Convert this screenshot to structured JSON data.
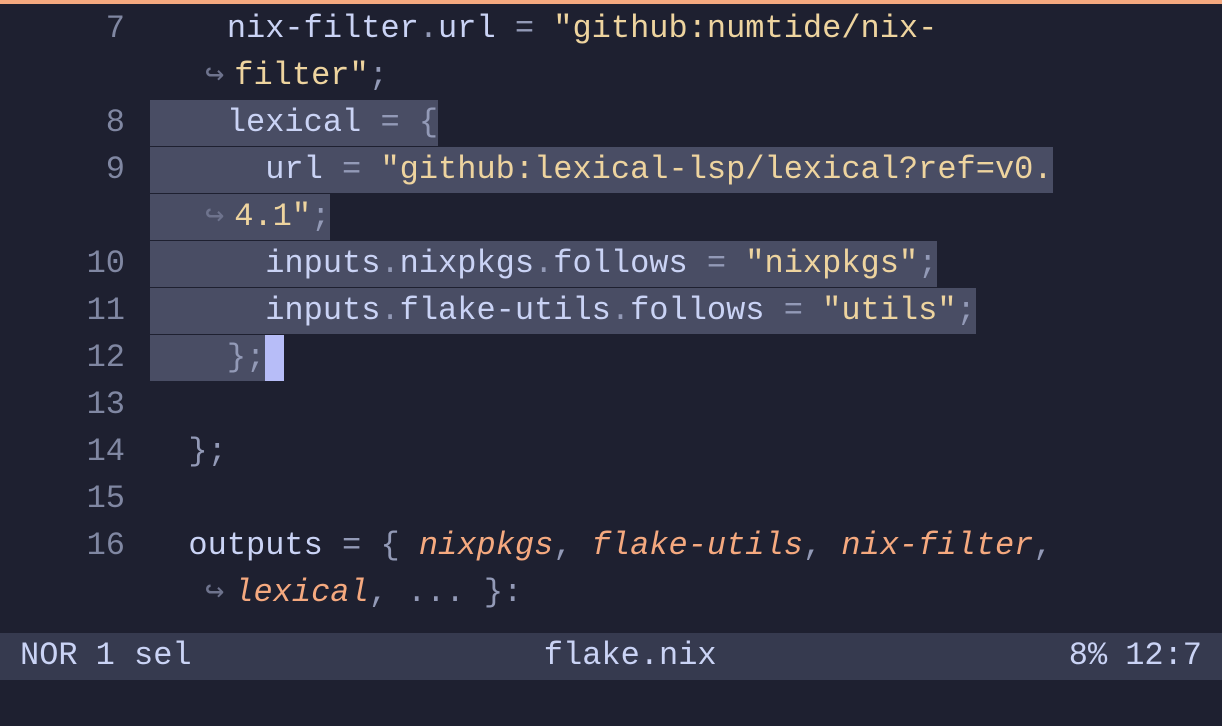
{
  "accent_color": "#f5a97f",
  "lines": [
    {
      "num": "7",
      "segments": [
        {
          "text": "    ",
          "cls": "t-plain"
        },
        {
          "text": "nix-filter",
          "cls": "t-ident"
        },
        {
          "text": ".",
          "cls": "t-punct"
        },
        {
          "text": "url ",
          "cls": "t-ident"
        },
        {
          "text": "=",
          "cls": "t-punct"
        },
        {
          "text": " ",
          "cls": "t-plain"
        },
        {
          "text": "\"github:numtide/nix-",
          "cls": "t-string"
        }
      ]
    },
    {
      "num": "",
      "wrap": true,
      "segments": [
        {
          "text": "filter\"",
          "cls": "t-string"
        },
        {
          "text": ";",
          "cls": "t-punct"
        }
      ]
    },
    {
      "num": "8",
      "segments": [
        {
          "text": "    ",
          "cls": "t-plain sel"
        },
        {
          "text": "lexical ",
          "cls": "t-ident sel"
        },
        {
          "text": "=",
          "cls": "t-punct sel"
        },
        {
          "text": " ",
          "cls": "t-plain sel"
        },
        {
          "text": "{",
          "cls": "t-punct sel"
        }
      ]
    },
    {
      "num": "9",
      "segments": [
        {
          "text": "      ",
          "cls": "t-plain sel"
        },
        {
          "text": "url ",
          "cls": "t-ident sel"
        },
        {
          "text": "=",
          "cls": "t-punct sel"
        },
        {
          "text": " ",
          "cls": "t-plain sel"
        },
        {
          "text": "\"github:lexical-lsp/lexical?ref=v0.",
          "cls": "t-string sel"
        }
      ]
    },
    {
      "num": "",
      "wrap": true,
      "wrap_sel": true,
      "segments": [
        {
          "text": "4.1\"",
          "cls": "t-string sel"
        },
        {
          "text": ";",
          "cls": "t-punct sel"
        }
      ]
    },
    {
      "num": "10",
      "segments": [
        {
          "text": "      ",
          "cls": "t-plain sel"
        },
        {
          "text": "inputs",
          "cls": "t-ident sel"
        },
        {
          "text": ".",
          "cls": "t-punct sel"
        },
        {
          "text": "nixpkgs",
          "cls": "t-ident sel"
        },
        {
          "text": ".",
          "cls": "t-punct sel"
        },
        {
          "text": "follows ",
          "cls": "t-ident sel"
        },
        {
          "text": "=",
          "cls": "t-punct sel"
        },
        {
          "text": " ",
          "cls": "t-plain sel"
        },
        {
          "text": "\"nixpkgs\"",
          "cls": "t-string sel"
        },
        {
          "text": ";",
          "cls": "t-punct sel"
        }
      ]
    },
    {
      "num": "11",
      "segments": [
        {
          "text": "      ",
          "cls": "t-plain sel"
        },
        {
          "text": "inputs",
          "cls": "t-ident sel"
        },
        {
          "text": ".",
          "cls": "t-punct sel"
        },
        {
          "text": "flake-utils",
          "cls": "t-ident sel"
        },
        {
          "text": ".",
          "cls": "t-punct sel"
        },
        {
          "text": "follows ",
          "cls": "t-ident sel"
        },
        {
          "text": "=",
          "cls": "t-punct sel"
        },
        {
          "text": " ",
          "cls": "t-plain sel"
        },
        {
          "text": "\"utils\"",
          "cls": "t-string sel"
        },
        {
          "text": ";",
          "cls": "t-punct sel"
        }
      ]
    },
    {
      "num": "12",
      "segments": [
        {
          "text": "    ",
          "cls": "t-plain sel"
        },
        {
          "text": "}",
          "cls": "t-punct sel"
        },
        {
          "text": ";",
          "cls": "t-punct sel"
        },
        {
          "text": " ",
          "cls": "cursor"
        }
      ]
    },
    {
      "num": "13",
      "segments": []
    },
    {
      "num": "14",
      "segments": [
        {
          "text": "  ",
          "cls": "t-plain"
        },
        {
          "text": "};",
          "cls": "t-punct"
        }
      ]
    },
    {
      "num": "15",
      "segments": []
    },
    {
      "num": "16",
      "segments": [
        {
          "text": "  ",
          "cls": "t-plain"
        },
        {
          "text": "outputs ",
          "cls": "t-ident"
        },
        {
          "text": "=",
          "cls": "t-punct"
        },
        {
          "text": " ",
          "cls": "t-plain"
        },
        {
          "text": "{",
          "cls": "t-punct"
        },
        {
          "text": " ",
          "cls": "t-plain"
        },
        {
          "text": "nixpkgs",
          "cls": "t-param"
        },
        {
          "text": ",",
          "cls": "t-punct"
        },
        {
          "text": " ",
          "cls": "t-plain"
        },
        {
          "text": "flake-utils",
          "cls": "t-param"
        },
        {
          "text": ",",
          "cls": "t-punct"
        },
        {
          "text": " ",
          "cls": "t-plain"
        },
        {
          "text": "nix-filter",
          "cls": "t-param"
        },
        {
          "text": ",",
          "cls": "t-punct"
        }
      ]
    },
    {
      "num": "",
      "wrap": true,
      "segments": [
        {
          "text": "lexical",
          "cls": "t-param"
        },
        {
          "text": ",",
          "cls": "t-punct"
        },
        {
          "text": " ",
          "cls": "t-plain"
        },
        {
          "text": "...",
          "cls": "t-punct"
        },
        {
          "text": " ",
          "cls": "t-plain"
        },
        {
          "text": "}:",
          "cls": "t-punct"
        }
      ]
    }
  ],
  "wrap_marker": "↪",
  "status": {
    "mode": "NOR",
    "selections": "1 sel",
    "filename": "flake.nix",
    "percent": "8%",
    "position": "12:7"
  }
}
